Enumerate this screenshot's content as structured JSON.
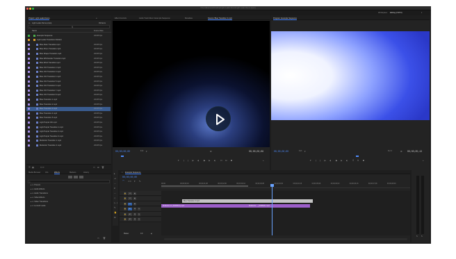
{
  "window": {
    "title": "/Users/Example/Desktop/Light Leaks Demo/Light Leaks Demo.prproj"
  },
  "workspace": {
    "label": "Workspace:",
    "value": "Editing (CS5.5)"
  },
  "project_panel": {
    "title": "Project: Light Leaks Demo",
    "path": "Light Leaks Demo.prproj",
    "item_count": "49 Items",
    "col_name": "Name",
    "col_rate": "Frame Rate",
    "rows": [
      {
        "name": "Example Sequence",
        "rate": "23.976 fps",
        "color": "#3fb24a",
        "sel": false
      },
      {
        "name": "Light Leaks Transitions Modern",
        "rate": "",
        "color": "#e0a030",
        "sel": false
      },
      {
        "name": "Blue Flare Transition.mp4",
        "rate": "23.976 fps",
        "color": "#a58ee8",
        "sel": false
      },
      {
        "name": "Blue Prism Transition.mp4",
        "rate": "23.976 fps",
        "color": "#a58ee8",
        "sel": false
      },
      {
        "name": "Blue Shape Transition.mp4",
        "rate": "23.976 fps",
        "color": "#a58ee8",
        "sel": false
      },
      {
        "name": "Blue Whirlwinder Transition.mp4",
        "rate": "23.976 fps",
        "color": "#a58ee8",
        "sel": false
      },
      {
        "name": "Blue Wind Transition.mp4",
        "rate": "23.976 fps",
        "color": "#a58ee8",
        "sel": false
      },
      {
        "name": "Blue Orb Transition 2.mp4",
        "rate": "23.976 fps",
        "color": "#a58ee8",
        "sel": false
      },
      {
        "name": "Blue Orb Transition 3.mp4",
        "rate": "23.976 fps",
        "color": "#a58ee8",
        "sel": false
      },
      {
        "name": "Blue Orb Transition 4.mp4",
        "rate": "23.976 fps",
        "color": "#a58ee8",
        "sel": false
      },
      {
        "name": "Blue Orb Transition 5.mp4",
        "rate": "23.976 fps",
        "color": "#a58ee8",
        "sel": false
      },
      {
        "name": "Blue Orb Transition 6.mp4",
        "rate": "23.976 fps",
        "color": "#a58ee8",
        "sel": false
      },
      {
        "name": "Blue Orb Transition 7.mp4",
        "rate": "23.976 fps",
        "color": "#a58ee8",
        "sel": false
      },
      {
        "name": "Blue Orb Transition 8.mp4",
        "rate": "23.976 fps",
        "color": "#a58ee8",
        "sel": false
      },
      {
        "name": "Blue Transition 1.mp4",
        "rate": "23.976 fps",
        "color": "#a58ee8",
        "sel": false
      },
      {
        "name": "Blue Transition 2.mp4",
        "rate": "23.976 fps",
        "color": "#a58ee8",
        "sel": false
      },
      {
        "name": "Blue Transition 3.mp4",
        "rate": "23.976 fps",
        "color": "#a58ee8",
        "sel": true
      },
      {
        "name": "Blue Transition 4.mp4",
        "rate": "23.976 fps",
        "color": "#a58ee8",
        "sel": false
      },
      {
        "name": "Blue Transition 5.mp4",
        "rate": "23.976 fps",
        "color": "#a58ee8",
        "sel": false
      },
      {
        "name": "Light Purple Orb.mp4",
        "rate": "23.976 fps",
        "color": "#a58ee8",
        "sel": false
      },
      {
        "name": "Light Purple Transition 1.mp4",
        "rate": "23.976 fps",
        "color": "#a58ee8",
        "sel": false
      },
      {
        "name": "Light Purple Transition 2.mp4",
        "rate": "23.976 fps",
        "color": "#a58ee8",
        "sel": false
      },
      {
        "name": "Light Purple Transition 3.mp4",
        "rate": "23.976 fps",
        "color": "#a58ee8",
        "sel": false
      },
      {
        "name": "Multicolor Transition 1.mp4",
        "rate": "23.976 fps",
        "color": "#a58ee8",
        "sel": false
      },
      {
        "name": "Multicolor Transition 2.mp4",
        "rate": "23.976 fps",
        "color": "#a58ee8",
        "sel": false
      }
    ]
  },
  "source_monitor": {
    "tabs": [
      "Effect Controls",
      "Audio Track Mixer: Example Sequence",
      "Metadata",
      "Source: Blue Transition 3.mp4"
    ],
    "active_tab": 3,
    "timecode": "00;00;00;00",
    "fit": "Fit",
    "duration": "00;00;03;08"
  },
  "program_monitor": {
    "tab": "Program: Example Sequence",
    "timecode": "00;00;00;00",
    "fit": "Fit",
    "quality": "Full",
    "duration": "00;00;05;13"
  },
  "effects_panel": {
    "tabs": [
      "Media Browser",
      "Info",
      "Effects",
      "Markers",
      "History"
    ],
    "active_tab": 2,
    "search_placeholder": "",
    "items": [
      "Presets",
      "Audio Effects",
      "Audio Transitions",
      "Video Effects",
      "Video Transitions",
      "Lumetri Looks"
    ]
  },
  "timeline": {
    "tab": "Example Sequence",
    "timecode": "00;00;00;00",
    "ruler": [
      "00;00",
      "00;00;00;16",
      "00;00;01;08",
      "00;00;02;00",
      "00;00;02;16",
      "00;00;03;08",
      "00;00;04;00",
      "00;00;04;16",
      "00;00;05;08",
      "00;00;06;00",
      "00;00;06;16",
      "00;00;07;08",
      "00;00;08;00"
    ],
    "tracks": [
      {
        "name": "V3"
      },
      {
        "name": "V2"
      },
      {
        "name": "V1"
      },
      {
        "name": "A1"
      },
      {
        "name": "A2"
      },
      {
        "name": "A3"
      }
    ],
    "master_label": "Master",
    "master_value": "0.0",
    "clips": {
      "v2": "Blue Transition 3.mp4",
      "v1a": "Multicolor 11 (NORMAL).mp4",
      "v1b": "Multicolor ..._NORMAL.mp4"
    }
  },
  "audio_meter": {
    "labels": [
      "S",
      "S"
    ]
  },
  "colors": {
    "accent": "#3f7fff",
    "selection": "#3a5c8f",
    "clip_v1": "#9c5fc9",
    "clip_v2": "#c5c5c5",
    "playhead": "#6aa3ff"
  }
}
